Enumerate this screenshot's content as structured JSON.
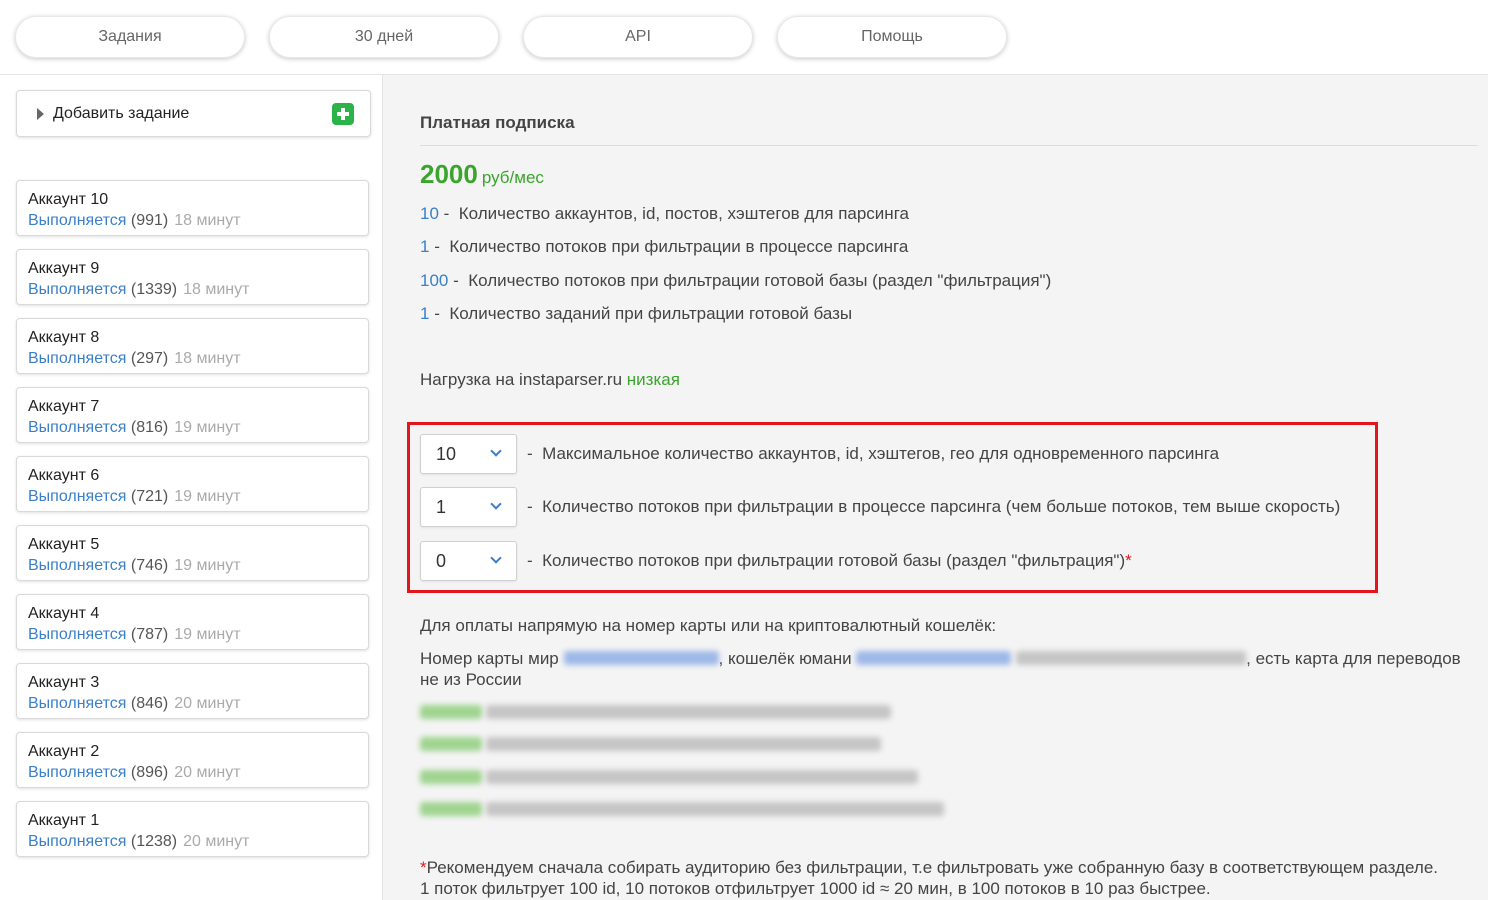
{
  "nav": {
    "tabs": [
      {
        "label": "Задания"
      },
      {
        "label": "30 дней"
      },
      {
        "label": "API"
      },
      {
        "label": "Помощь"
      }
    ]
  },
  "sidebar": {
    "add_task_label": "Добавить задание",
    "accounts": [
      {
        "name": "Аккаунт 10",
        "status": "Выполняется",
        "count": "(991)",
        "time": "18 минут"
      },
      {
        "name": "Аккаунт 9",
        "status": "Выполняется",
        "count": "(1339)",
        "time": "18 минут"
      },
      {
        "name": "Аккаунт 8",
        "status": "Выполняется",
        "count": "(297)",
        "time": "18 минут"
      },
      {
        "name": "Аккаунт 7",
        "status": "Выполняется",
        "count": "(816)",
        "time": "19 минут"
      },
      {
        "name": "Аккаунт 6",
        "status": "Выполняется",
        "count": "(721)",
        "time": "19 минут"
      },
      {
        "name": "Аккаунт 5",
        "status": "Выполняется",
        "count": "(746)",
        "time": "19 минут"
      },
      {
        "name": "Аккаунт 4",
        "status": "Выполняется",
        "count": "(787)",
        "time": "19 минут"
      },
      {
        "name": "Аккаунт 3",
        "status": "Выполняется",
        "count": "(846)",
        "time": "20 минут"
      },
      {
        "name": "Аккаунт 2",
        "status": "Выполняется",
        "count": "(896)",
        "time": "20 минут"
      },
      {
        "name": "Аккаунт 1",
        "status": "Выполняется",
        "count": "(1238)",
        "time": "20 минут"
      }
    ]
  },
  "main": {
    "plan_title": "Платная подписка",
    "price": "2000",
    "price_unit": "руб/мес",
    "features": [
      {
        "n": "10",
        "text": "Количество аккаунтов, id, постов, хэштегов для парсинга"
      },
      {
        "n": "1",
        "text": "Количество потоков при фильтрации в процессе парсинга"
      },
      {
        "n": "100",
        "text": "Количество потоков при фильтрации готовой базы (раздел \"фильтрация\")"
      },
      {
        "n": "1",
        "text": "Количество заданий при фильтрации готовой базы"
      }
    ],
    "load_label": "Нагрузка на instaparser.ru",
    "load_value": "низкая",
    "selects": [
      {
        "value": "10",
        "desc": "Максимальное количество аккаунтов, id, хэштегов, гео для одновременного парсинга"
      },
      {
        "value": "1",
        "desc": "Количество потоков при фильтрации в процессе парсинга (чем больше потоков, тем выше скорость)"
      },
      {
        "value": "0",
        "desc": "Количество потоков при фильтрации готовой базы (раздел \"фильтрация\")"
      }
    ],
    "asterisk": "*",
    "payment_intro": "Для оплаты напрямую на номер карты или на криптовалютный кошелёк:",
    "card_label": "Номер карты мир",
    "wallet_label": ", кошелёк юмани",
    "card_tail": ", есть карта для переводов",
    "card_tail2": "не из России",
    "note_line1": "Рекомендуем сначала собирать аудиторию без фильтрации, т.е фильтровать уже собранную базу в соответствующем разделе.",
    "note_line2": "1 поток фильтрует 100 id, 10 потоков отфильтрует 1000 id ≈ 20 мин, в 100 потоков в 10 раз быстрее."
  },
  "colors": {
    "accent_blue": "#3a7fc8",
    "green": "#3aa52c",
    "highlight_red": "#e3161b"
  }
}
